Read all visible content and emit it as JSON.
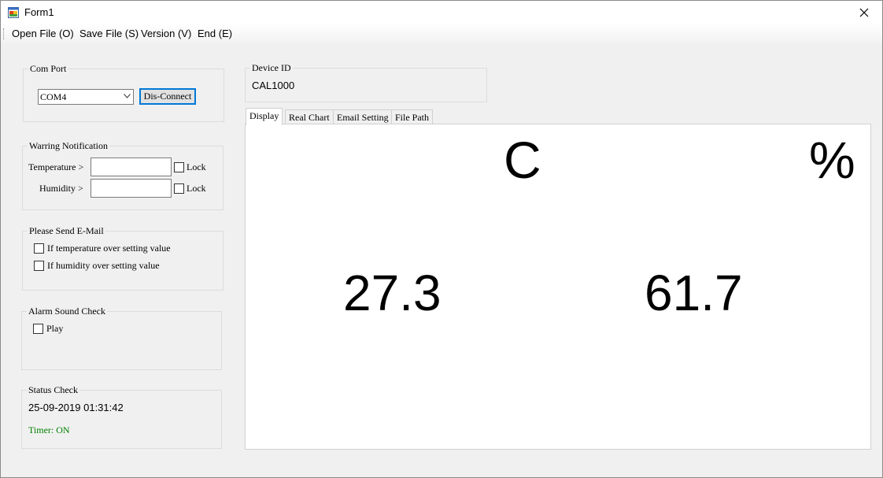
{
  "window": {
    "title": "Form1",
    "close_glyph": "✕"
  },
  "menu": {
    "items": [
      "Open File (O)",
      "Save File (S)",
      "Version (V)",
      "End (E)"
    ]
  },
  "com_port": {
    "label": "Com Port",
    "selected": "COM4",
    "button_label": "Dis-Connect"
  },
  "device": {
    "label": "Device ID",
    "value": "CAL1000"
  },
  "warning": {
    "label": "Warring Notification",
    "temperature_label": "Temperature >",
    "humidity_label": "Humidity >",
    "temperature_value": "",
    "humidity_value": "",
    "lock_label": "Lock"
  },
  "email": {
    "label": "Please Send E-Mail",
    "temp_option": "If temperature over setting value",
    "hum_option": "If humidity over setting value"
  },
  "alarm": {
    "label": "Alarm Sound Check",
    "play_label": "Play"
  },
  "status": {
    "label": "Status Check",
    "datetime": "25-09-2019 01:31:42",
    "timer": "Timer: ON",
    "timer_color": "#008000"
  },
  "tabs": [
    "Display",
    "Real Chart",
    "Email Setting",
    "File Path"
  ],
  "display": {
    "temp_unit": "C",
    "hum_unit": "%",
    "temperature": "27.3",
    "humidity": "61.7"
  }
}
